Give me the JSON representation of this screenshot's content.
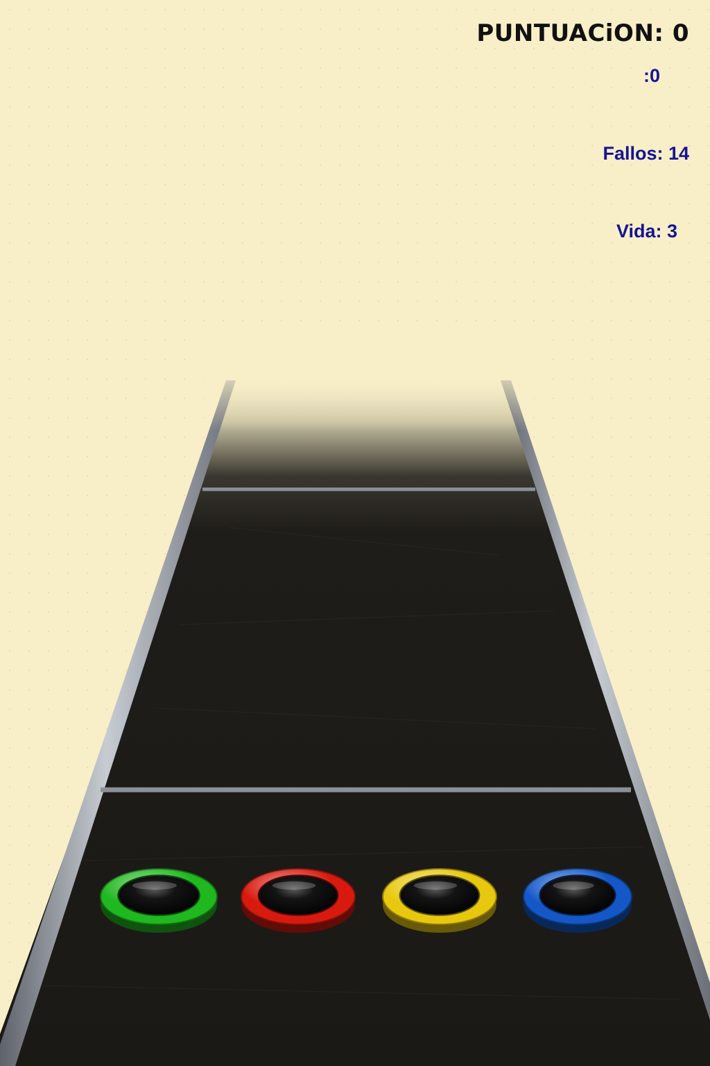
{
  "hud": {
    "score_label": "PUNTUACiON: 0",
    "streak_label": ":0",
    "misses_label": "Fallos: 14",
    "life_label": "Vida: 3"
  },
  "colors": {
    "background": "#f8efc8",
    "highway": "#1d1b17",
    "rail": "#9aa0a8",
    "fret_green": "#1fb81f",
    "fret_red": "#d81a0e",
    "fret_yellow": "#e8c80e",
    "fret_blue": "#1458c8",
    "hud_blue": "#141496",
    "hud_black": "#111111"
  },
  "frets": [
    {
      "name": "fret-button-green",
      "color": "#1fb81f"
    },
    {
      "name": "fret-button-red",
      "color": "#d81a0e"
    },
    {
      "name": "fret-button-yellow",
      "color": "#e8c80e"
    },
    {
      "name": "fret-button-blue",
      "color": "#1458c8"
    }
  ]
}
